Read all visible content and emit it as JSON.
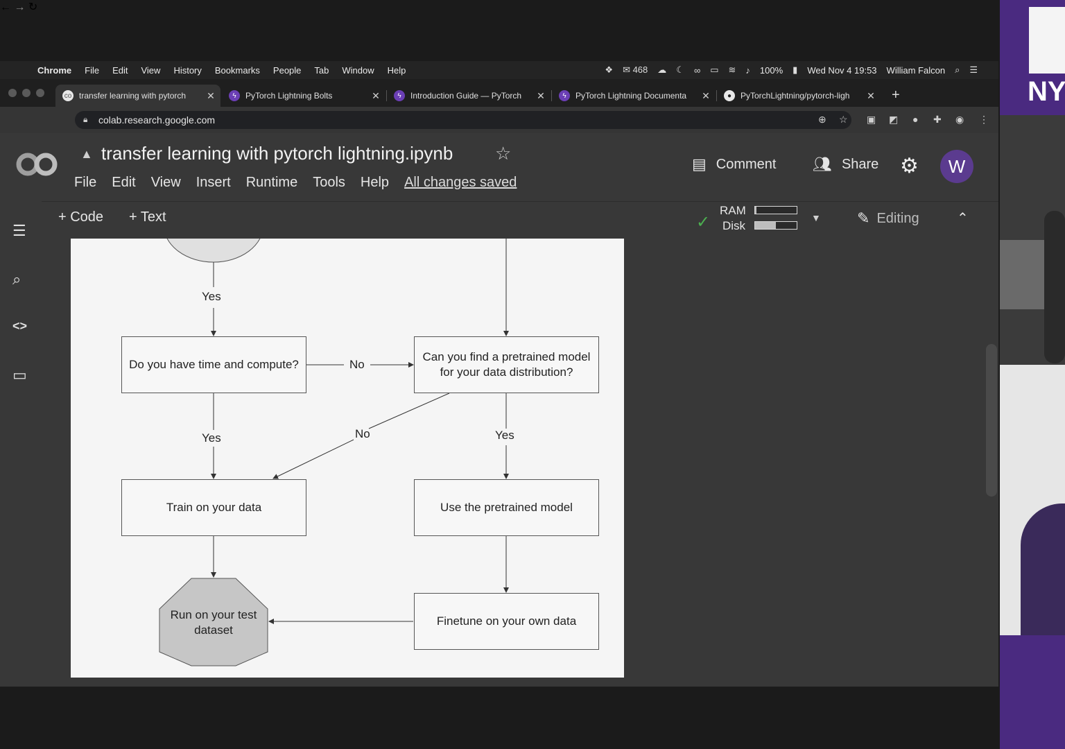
{
  "menubar": {
    "app": "Chrome",
    "items": [
      "File",
      "Edit",
      "View",
      "History",
      "Bookmarks",
      "People",
      "Tab",
      "Window",
      "Help"
    ],
    "mail_count": "468",
    "battery": "100%",
    "datetime": "Wed Nov 4  19:53",
    "user": "William Falcon"
  },
  "tabs": [
    {
      "title": "transfer learning with pytorch",
      "active": true
    },
    {
      "title": "PyTorch Lightning Bolts",
      "active": false
    },
    {
      "title": "Introduction Guide — PyTorch",
      "active": false
    },
    {
      "title": "PyTorch Lightning Documenta",
      "active": false
    },
    {
      "title": "PyTorchLightning/pytorch-ligh",
      "active": false
    }
  ],
  "address": {
    "url": "colab.research.google.com"
  },
  "colab": {
    "logo": "CO",
    "title": "transfer learning with pytorch lightning.ipynb",
    "menu": [
      "File",
      "Edit",
      "View",
      "Insert",
      "Runtime",
      "Tools",
      "Help"
    ],
    "saved_status": "All changes saved",
    "comment_label": "Comment",
    "share_label": "Share",
    "avatar_letter": "W",
    "add_code": "+ Code",
    "add_text": "+ Text",
    "ram_label": "RAM",
    "disk_label": "Disk",
    "ram_usage": 0.03,
    "disk_usage": 0.5,
    "editing_label": "Editing"
  },
  "flowchart": {
    "yes_top": "Yes",
    "box_time": "Do you have time and compute?",
    "no_right": "No",
    "box_pretrained_q": "Can you find a pretrained model for your data distribution?",
    "yes_left": "Yes",
    "no_diag": "No",
    "yes_right": "Yes",
    "box_train": "Train on your data",
    "box_use_pretrained": "Use the pretrained model",
    "box_finetune": "Finetune on your own data",
    "octagon": "Run on your test dataset"
  },
  "cam": {
    "logo_text": "NY"
  }
}
